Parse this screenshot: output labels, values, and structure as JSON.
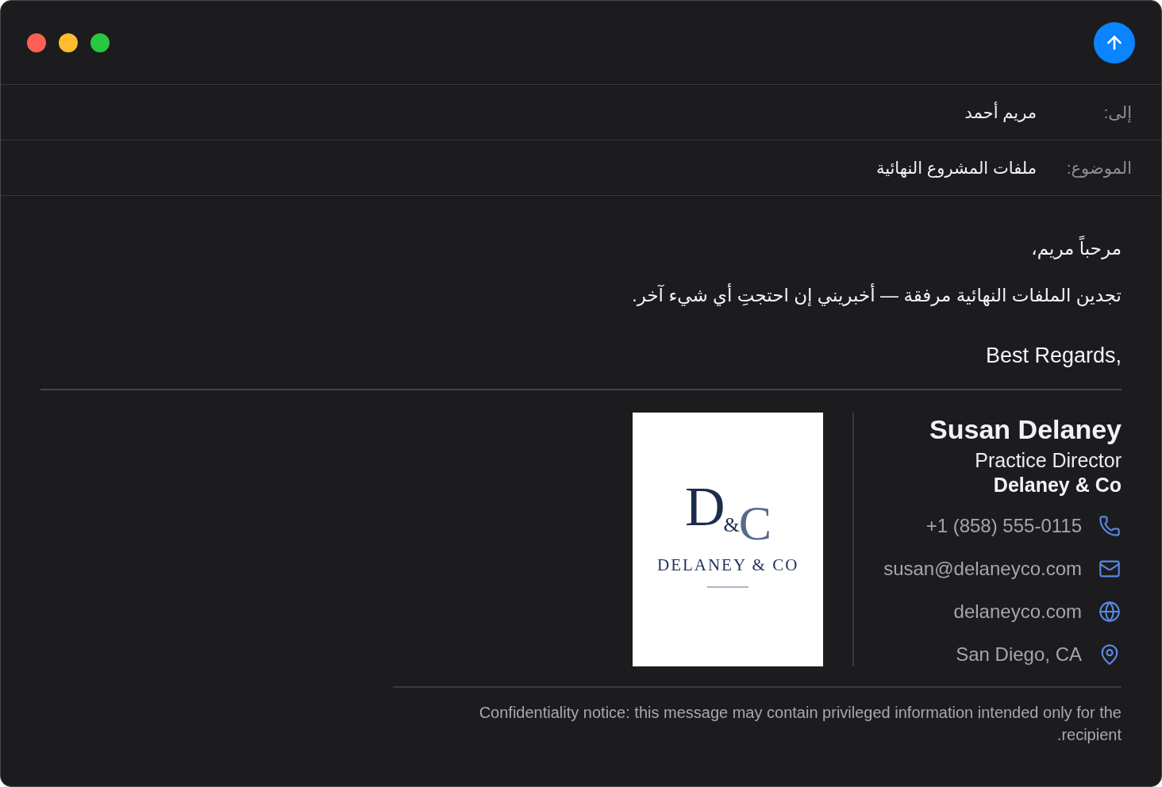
{
  "window": {
    "controls": [
      {
        "color": "#ff5f57"
      },
      {
        "color": "#febc2e"
      },
      {
        "color": "#28c840"
      }
    ]
  },
  "header_fields": [
    {
      "label": "إلى:",
      "value": "مريم أحمد"
    },
    {
      "label": "الموضوع:",
      "value": "ملفات المشروع النهائية"
    }
  ],
  "body": {
    "paragraphs": [
      "مرحباً مريم،",
      "تجدين الملفات النهائية مرفقة — أخبريني إن احتجتِ أي شيء آخر."
    ],
    "closing": "Best Regards,"
  },
  "signature": {
    "logo": {
      "monogram": "D&C",
      "wordmark": "DELANEY & CO"
    },
    "name": "Susan Delaney",
    "title": "Practice Director",
    "company": "Delaney & Co",
    "contacts": [
      {
        "kind": "phone",
        "text": "+1 (858) 555-0115"
      },
      {
        "kind": "email",
        "text": "susan@delaneyco.com"
      },
      {
        "kind": "website",
        "text": "delaneyco.com"
      },
      {
        "kind": "location",
        "text": "San Diego, CA"
      }
    ]
  },
  "disclaimer": "Confidentiality notice: this message may contain privileged information intended only for the recipient."
}
